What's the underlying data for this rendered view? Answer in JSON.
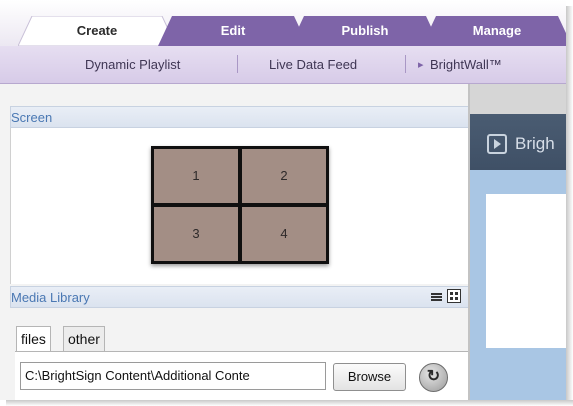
{
  "tabs": [
    {
      "label": "Create",
      "active": true
    },
    {
      "label": "Edit",
      "active": false
    },
    {
      "label": "Publish",
      "active": false
    },
    {
      "label": "Manage",
      "active": false
    }
  ],
  "subnav": {
    "items": [
      "Dynamic Playlist",
      "Live Data Feed",
      "BrightWall™"
    ],
    "bullet": "▸"
  },
  "screen": {
    "header": "Screen",
    "cells": [
      "1",
      "2",
      "3",
      "4"
    ]
  },
  "media_library": {
    "header": "Media Library",
    "view_icons": [
      "list-view-icon",
      "grid-view-icon"
    ],
    "tabs": [
      "files",
      "other"
    ],
    "path": "C:\\BrightSign Content\\Additional Conte",
    "browse_label": "Browse"
  },
  "preview": {
    "title": "Brigh"
  },
  "colors": {
    "tab_purple": "#7e64a8",
    "tab_active": "#ffffff",
    "subnav_bg": "#e0d6ee",
    "cell_fill": "#a38e85",
    "header_text": "#4a78b3"
  }
}
